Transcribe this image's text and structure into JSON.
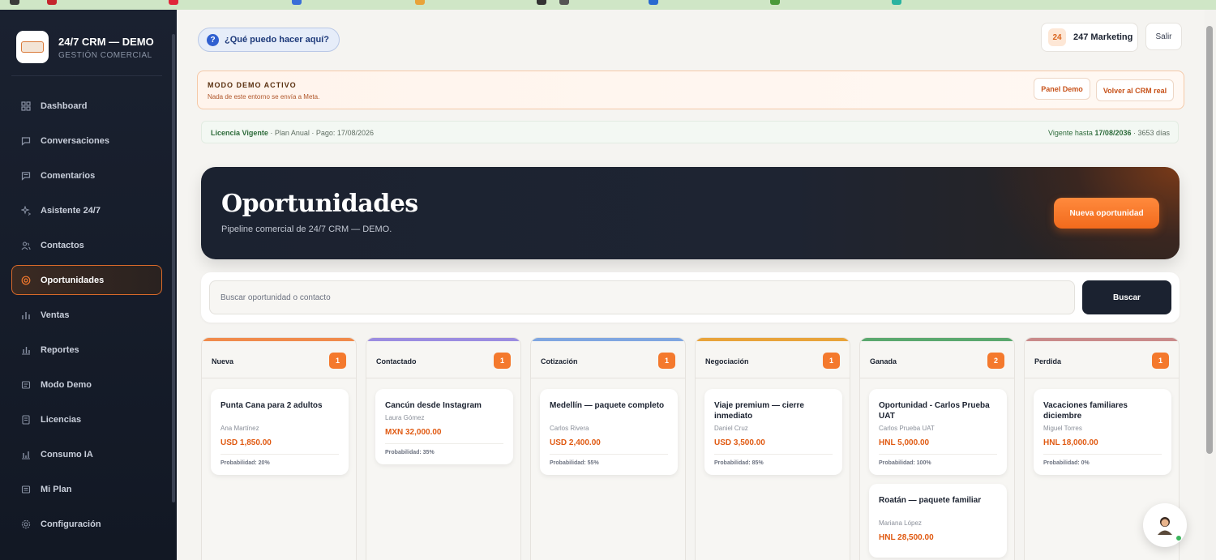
{
  "brand": {
    "title": "24/7 CRM — DEMO",
    "subtitle": "GESTIÓN COMERCIAL"
  },
  "sidebar": {
    "items": [
      {
        "label": "Dashboard",
        "icon": "grid-icon"
      },
      {
        "label": "Conversaciones",
        "icon": "chat-icon"
      },
      {
        "label": "Comentarios",
        "icon": "comment-icon"
      },
      {
        "label": "Asistente 24/7",
        "icon": "sparkle-icon"
      },
      {
        "label": "Contactos",
        "icon": "users-icon"
      },
      {
        "label": "Oportunidades",
        "icon": "target-icon",
        "active": true
      },
      {
        "label": "Ventas",
        "icon": "bars-icon"
      },
      {
        "label": "Reportes",
        "icon": "chart-icon"
      },
      {
        "label": "Modo Demo",
        "icon": "demo-icon"
      },
      {
        "label": "Licencias",
        "icon": "document-icon"
      },
      {
        "label": "Consumo IA",
        "icon": "usage-icon"
      },
      {
        "label": "Mi Plan",
        "icon": "plan-icon"
      },
      {
        "label": "Configuración",
        "icon": "gear-icon"
      }
    ]
  },
  "header": {
    "help_label": "¿Qué puedo hacer aquí?",
    "help_glyph": "?",
    "account_badge": "24",
    "account_name": "247 Marketing",
    "logout_label": "Salir"
  },
  "demo_banner": {
    "title": "MODO DEMO ACTIVO",
    "text": "Nada de este entorno se envía a Meta.",
    "panel_label": "Panel Demo",
    "back_label": "Volver al CRM real"
  },
  "license": {
    "status": "Licencia Vigente",
    "details": " · Plan Anual · Pago: 17/08/2026",
    "valid_prefix": "Vigente hasta ",
    "valid_date": "17/08/2036",
    "valid_suffix": " · 3653 días"
  },
  "hero": {
    "title": "Oportunidades",
    "subtitle": "Pipeline comercial de 24/7 CRM — DEMO.",
    "new_label": "Nueva oportunidad"
  },
  "search": {
    "placeholder": "Buscar oportunidad o contacto",
    "button_label": "Buscar"
  },
  "colors": {
    "accent": "#f4792d",
    "amount": "#e05a12",
    "stage_nueva": "#f08a4b",
    "stage_contactado": "#9b8ce0",
    "stage_cotizacion": "#7fa6e0",
    "stage_negociacion": "#e8a33a",
    "stage_ganada": "#5aa86e",
    "stage_perdida": "#c98a8a"
  },
  "board": {
    "columns": [
      {
        "name": "Nueva",
        "count": "1",
        "cards": [
          {
            "title": "Punta Cana para 2 adultos",
            "contact": "Ana Martínez",
            "amount": "USD 1,850.00",
            "probability": "Probabilidad: 20%"
          }
        ]
      },
      {
        "name": "Contactado",
        "count": "1",
        "cards": [
          {
            "title": "Cancún desde Instagram",
            "contact": "Laura Gómez",
            "amount": "MXN 32,000.00",
            "probability": "Probabilidad: 35%"
          }
        ]
      },
      {
        "name": "Cotización",
        "count": "1",
        "cards": [
          {
            "title": "Medellín — paquete completo",
            "contact": "Carlos Rivera",
            "amount": "USD 2,400.00",
            "probability": "Probabilidad: 55%"
          }
        ]
      },
      {
        "name": "Negociación",
        "count": "1",
        "cards": [
          {
            "title": "Viaje premium — cierre inmediato",
            "contact": "Daniel Cruz",
            "amount": "USD 3,500.00",
            "probability": "Probabilidad: 85%"
          }
        ]
      },
      {
        "name": "Ganada",
        "count": "2",
        "cards": [
          {
            "title": "Oportunidad - Carlos Prueba UAT",
            "contact": "Carlos Prueba UAT",
            "amount": "HNL 5,000.00",
            "probability": "Probabilidad: 100%"
          },
          {
            "title": "Roatán — paquete familiar",
            "contact": "Mariana López",
            "amount": "HNL 28,500.00",
            "probability": ""
          }
        ]
      },
      {
        "name": "Perdida",
        "count": "1",
        "cards": [
          {
            "title": "Vacaciones familiares diciembre",
            "contact": "Miguel Torres",
            "amount": "HNL 18,000.00",
            "probability": "Probabilidad: 0%"
          }
        ]
      }
    ]
  }
}
